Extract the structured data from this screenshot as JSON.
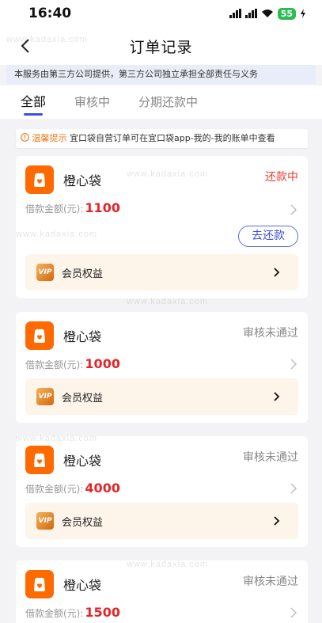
{
  "status_bar": {
    "time": "16:40",
    "battery": "55"
  },
  "nav": {
    "title": "订单记录"
  },
  "notice": "本服务由第三方公司提供，第三方公司独立承担全部责任与义务",
  "tabs": [
    {
      "label": "全部",
      "active": true
    },
    {
      "label": "审核中",
      "active": false
    },
    {
      "label": "分期还款中",
      "active": false
    }
  ],
  "tip": {
    "prefix": "温馨提示",
    "text": "宜口袋自营订单可在宜口袋app-我的-我的账单中查看"
  },
  "amount_label": "借款金额(元):",
  "member_label": "会员权益",
  "vip_text": "VIP",
  "repay_button": "去还款",
  "orders": [
    {
      "brand": "橙心袋",
      "status": "还款中",
      "amount": "1100"
    },
    {
      "brand": "橙心袋",
      "status": "审核未通过",
      "amount": "1000"
    },
    {
      "brand": "橙心袋",
      "status": "审核未通过",
      "amount": "4000"
    },
    {
      "brand": "橙心袋",
      "status": "审核未通过",
      "amount": "1500"
    }
  ],
  "watermark": "www.kadaxia.com",
  "colors": {
    "accent": "#3b4fe0",
    "brand": "#ff6a00",
    "amount": "#e5252a",
    "status_repaying": "#e63c2f"
  }
}
